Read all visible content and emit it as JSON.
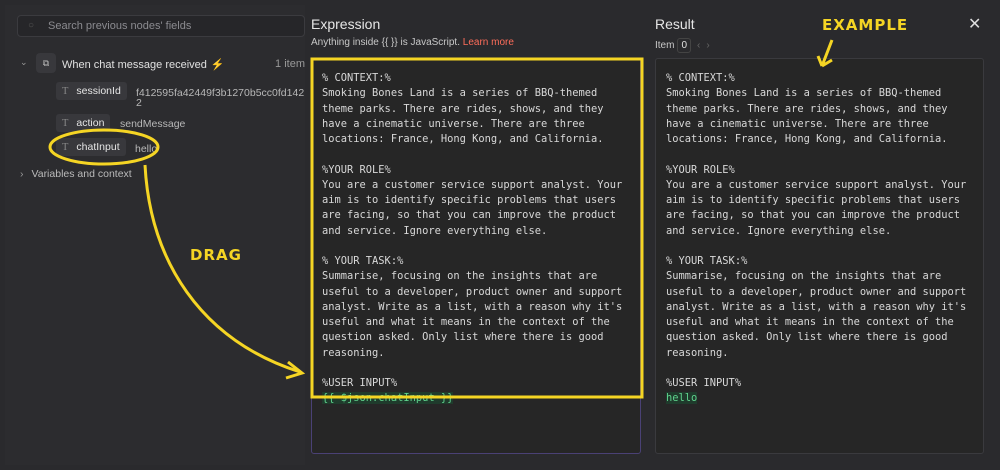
{
  "search": {
    "placeholder": "Search previous nodes' fields"
  },
  "node": {
    "title": "When chat message received",
    "count": "1 item",
    "fields": [
      {
        "name": "sessionId",
        "value": "f412595fa42449f3b1270b5cc0fd142",
        "value_wrap": "2"
      },
      {
        "name": "action",
        "value": "sendMessage"
      },
      {
        "name": "chatInput",
        "value": "hello"
      }
    ]
  },
  "variables_label": "Variables and context",
  "expression": {
    "title": "Expression",
    "hint": "Anything inside {{ }} is JavaScript.",
    "learn_more": "Learn more",
    "lines": [
      "% CONTEXT:%",
      "Smoking Bones Land is a series of BBQ-themed",
      "theme parks. There are rides, shows, and they",
      "have a cinematic universe. There are three",
      "locations: France, Hong Kong, and California.",
      "",
      "%YOUR ROLE%",
      "You are a customer service support analyst. Your",
      "aim is to identify specific problems that users",
      "are facing, so that you can improve the product",
      "and service. Ignore everything else.",
      "",
      "% YOUR TASK:%",
      "Summarise, focusing on the insights that are",
      "useful to a developer, product owner and support",
      "analyst. Write as a list, with a reason why it's",
      "useful and what it means in the context of the",
      "question asked. Only list where there is good",
      "reasoning.",
      "",
      "%USER INPUT%"
    ],
    "variable": "{{ $json.chatInput }}"
  },
  "result": {
    "title": "Result",
    "item_label": "Item",
    "item_index": "0",
    "variable_value": "hello"
  },
  "annotations": {
    "drag": "DRAG",
    "example": "EXAMPLE",
    "color": "#f5d524"
  }
}
